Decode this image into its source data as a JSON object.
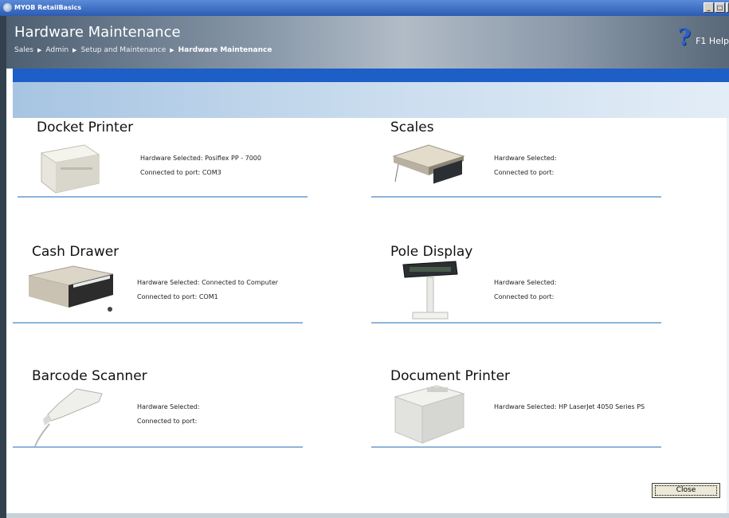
{
  "window": {
    "title": "MYOB RetailBasics"
  },
  "header": {
    "title": "Hardware Maintenance",
    "breadcrumb": [
      "Sales",
      "Admin",
      "Setup and Maintenance",
      "Hardware Maintenance"
    ],
    "help_label": "F1 Help"
  },
  "devices": [
    {
      "name": "Docket Printer",
      "hardware_selected": "Hardware Selected: Posiflex PP - 7000",
      "port": "Connected to port: COM3"
    },
    {
      "name": "Scales",
      "hardware_selected": "Hardware Selected:",
      "port": "Connected to port:"
    },
    {
      "name": "Cash Drawer",
      "hardware_selected": "Hardware Selected: Connected to Computer",
      "port": "Connected to port: COM1"
    },
    {
      "name": "Pole Display",
      "hardware_selected": "Hardware Selected:",
      "port": "Connected to port:"
    },
    {
      "name": "Barcode Scanner",
      "hardware_selected": "Hardware Selected:",
      "port": "Connected to port:"
    },
    {
      "name": "Document Printer",
      "hardware_selected": "Hardware Selected: HP LaserJet 4050 Series PS"
    }
  ],
  "buttons": {
    "close": "Close"
  },
  "colors": {
    "accent_blue": "#1d5ec7",
    "divider": "#8fb4da"
  }
}
